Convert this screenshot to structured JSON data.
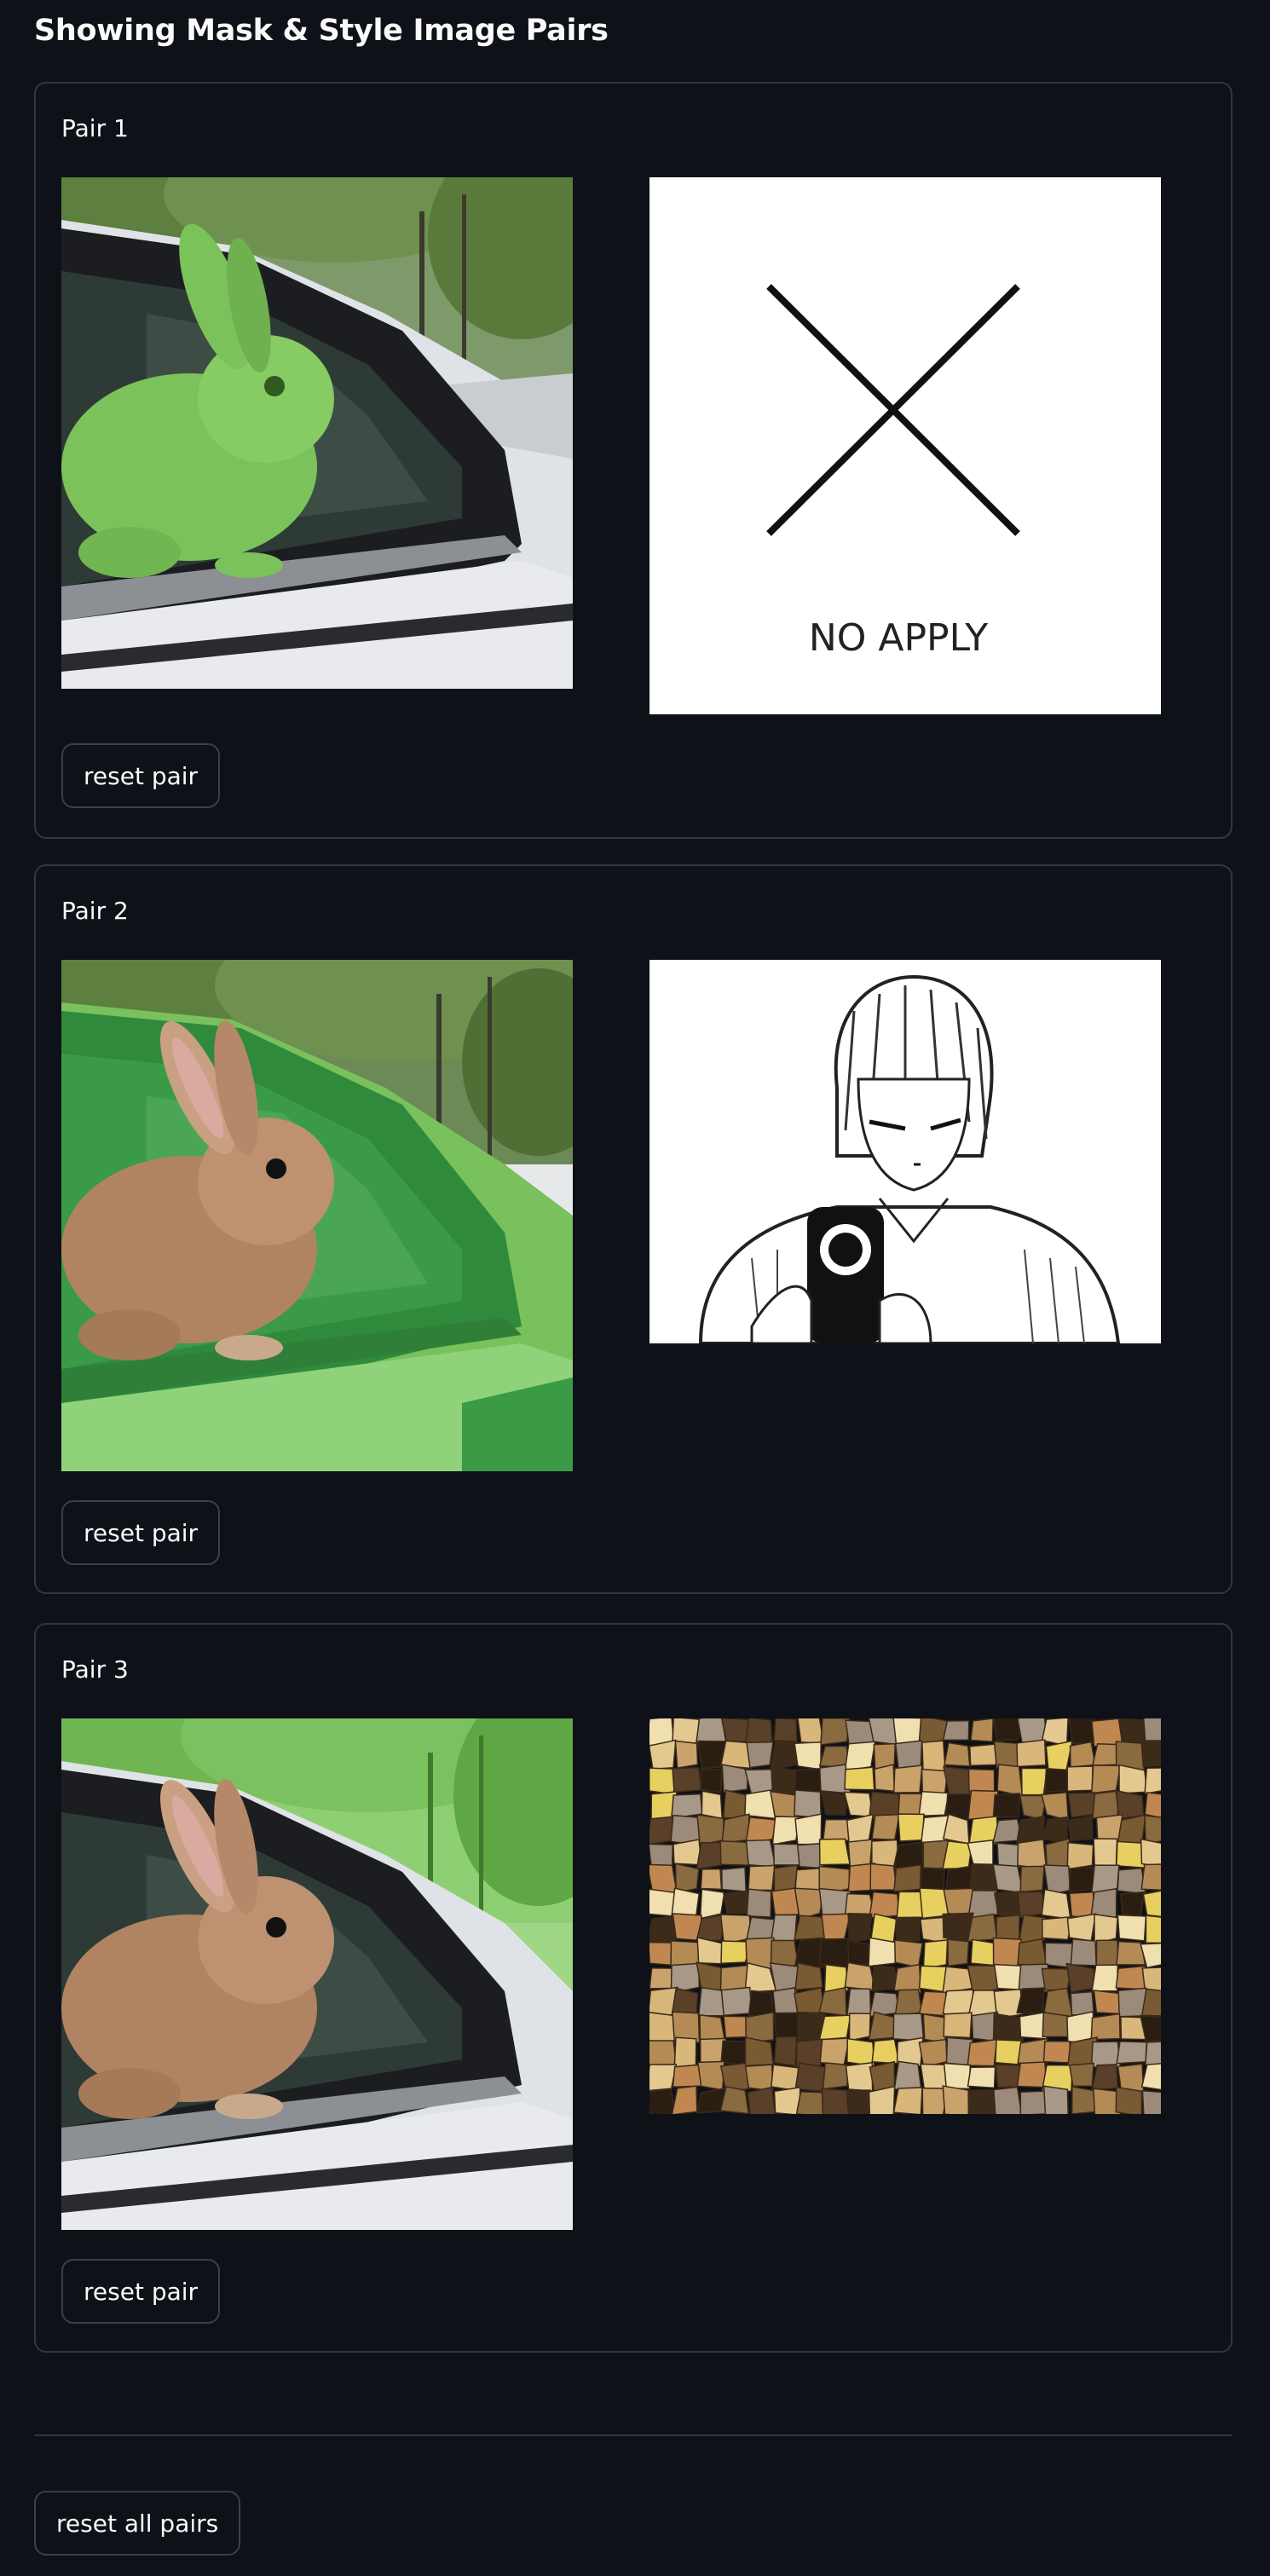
{
  "page": {
    "title": "Showing Mask & Style Image Pairs"
  },
  "pairs": [
    {
      "label": "Pair 1",
      "mask_image": "rabbit in car window, rabbit masked green",
      "style_image": "no-apply placeholder",
      "style_text": "NO APPLY",
      "reset_label": "reset pair"
    },
    {
      "label": "Pair 2",
      "mask_image": "rabbit in car window, car masked green",
      "style_image": "manga character pointing a gun",
      "reset_label": "reset pair"
    },
    {
      "label": "Pair 3",
      "mask_image": "rabbit in car window, background masked green",
      "style_image": "brown mosaic texture",
      "reset_label": "reset pair"
    }
  ],
  "footer": {
    "reset_all_label": "reset all pairs"
  },
  "colors": {
    "background": "#0e1117",
    "border": "#33363f",
    "text": "#fafafa",
    "mask_green": "#6fbf4a"
  }
}
